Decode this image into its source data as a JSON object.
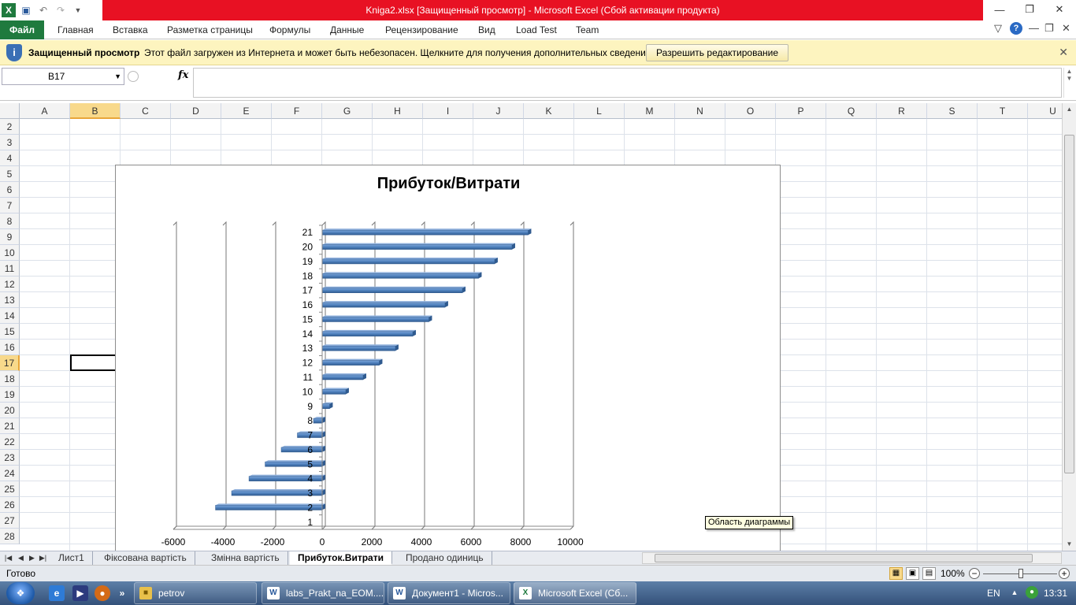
{
  "window": {
    "title": "Kniga2.xlsx  [Защищенный просмотр]  -  Microsoft Excel (Сбой активации продукта)"
  },
  "ribbon": {
    "tabs": [
      "Файл",
      "Главная",
      "Вставка",
      "Разметка страницы",
      "Формулы",
      "Данные",
      "Рецензирование",
      "Вид",
      "Load Test",
      "Team"
    ]
  },
  "protected_view": {
    "title": "Защищенный просмотр",
    "message": "Этот файл загружен из Интернета и может быть небезопасен. Щелкните для получения дополнительных сведений.",
    "button": "Разрешить редактирование"
  },
  "formula_bar": {
    "name_box": "B17",
    "fx": "fx",
    "value": ""
  },
  "grid": {
    "columns": [
      "A",
      "B",
      "C",
      "D",
      "E",
      "F",
      "G",
      "H",
      "I",
      "J",
      "K",
      "L",
      "M",
      "N",
      "O",
      "P",
      "Q",
      "R",
      "S",
      "T",
      "U"
    ],
    "selected_column": "B",
    "rows": [
      "2",
      "3",
      "4",
      "5",
      "6",
      "7",
      "8",
      "9",
      "10",
      "11",
      "12",
      "13",
      "14",
      "15",
      "16",
      "17",
      "18",
      "19",
      "20",
      "21",
      "22",
      "23",
      "24",
      "25",
      "26",
      "27",
      "28"
    ],
    "selected_row": "17"
  },
  "chart_data": {
    "type": "bar",
    "title": "Прибуток/Витрати",
    "xlabel": "",
    "ylabel": "",
    "xlim": [
      -6000,
      10000
    ],
    "x_ticks": [
      "-6000",
      "-4000",
      "-2000",
      "0",
      "2000",
      "4000",
      "6000",
      "8000",
      "10000"
    ],
    "gridlines": "vertical",
    "legend": "none",
    "bar_color": "#4f81bd",
    "categories": [
      "1",
      "2",
      "3",
      "4",
      "5",
      "6",
      "7",
      "8",
      "9",
      "10",
      "11",
      "12",
      "13",
      "14",
      "15",
      "16",
      "17",
      "18",
      "19",
      "20",
      "21"
    ],
    "values": [
      0,
      -4300,
      -3650,
      -2950,
      -2300,
      -1650,
      -1000,
      -350,
      300,
      950,
      1650,
      2300,
      2950,
      3650,
      4300,
      4950,
      5650,
      6300,
      6950,
      7650,
      8300
    ]
  },
  "tooltip": "Область диаграммы",
  "sheets": {
    "tabs": [
      "Лист1",
      "Фіксована вартість",
      "Змінна вартість",
      "Прибуток.Витрати",
      "Продано одиниць"
    ],
    "active": "Прибуток.Витрати"
  },
  "status": {
    "ready": "Готово",
    "zoom": "100%"
  },
  "taskbar": {
    "apps": [
      "petrov",
      "labs_Prakt_na_EOM....",
      "Документ1 - Micros...",
      "Microsoft Excel (Сб..."
    ],
    "lang": "EN",
    "clock": "13:31"
  }
}
